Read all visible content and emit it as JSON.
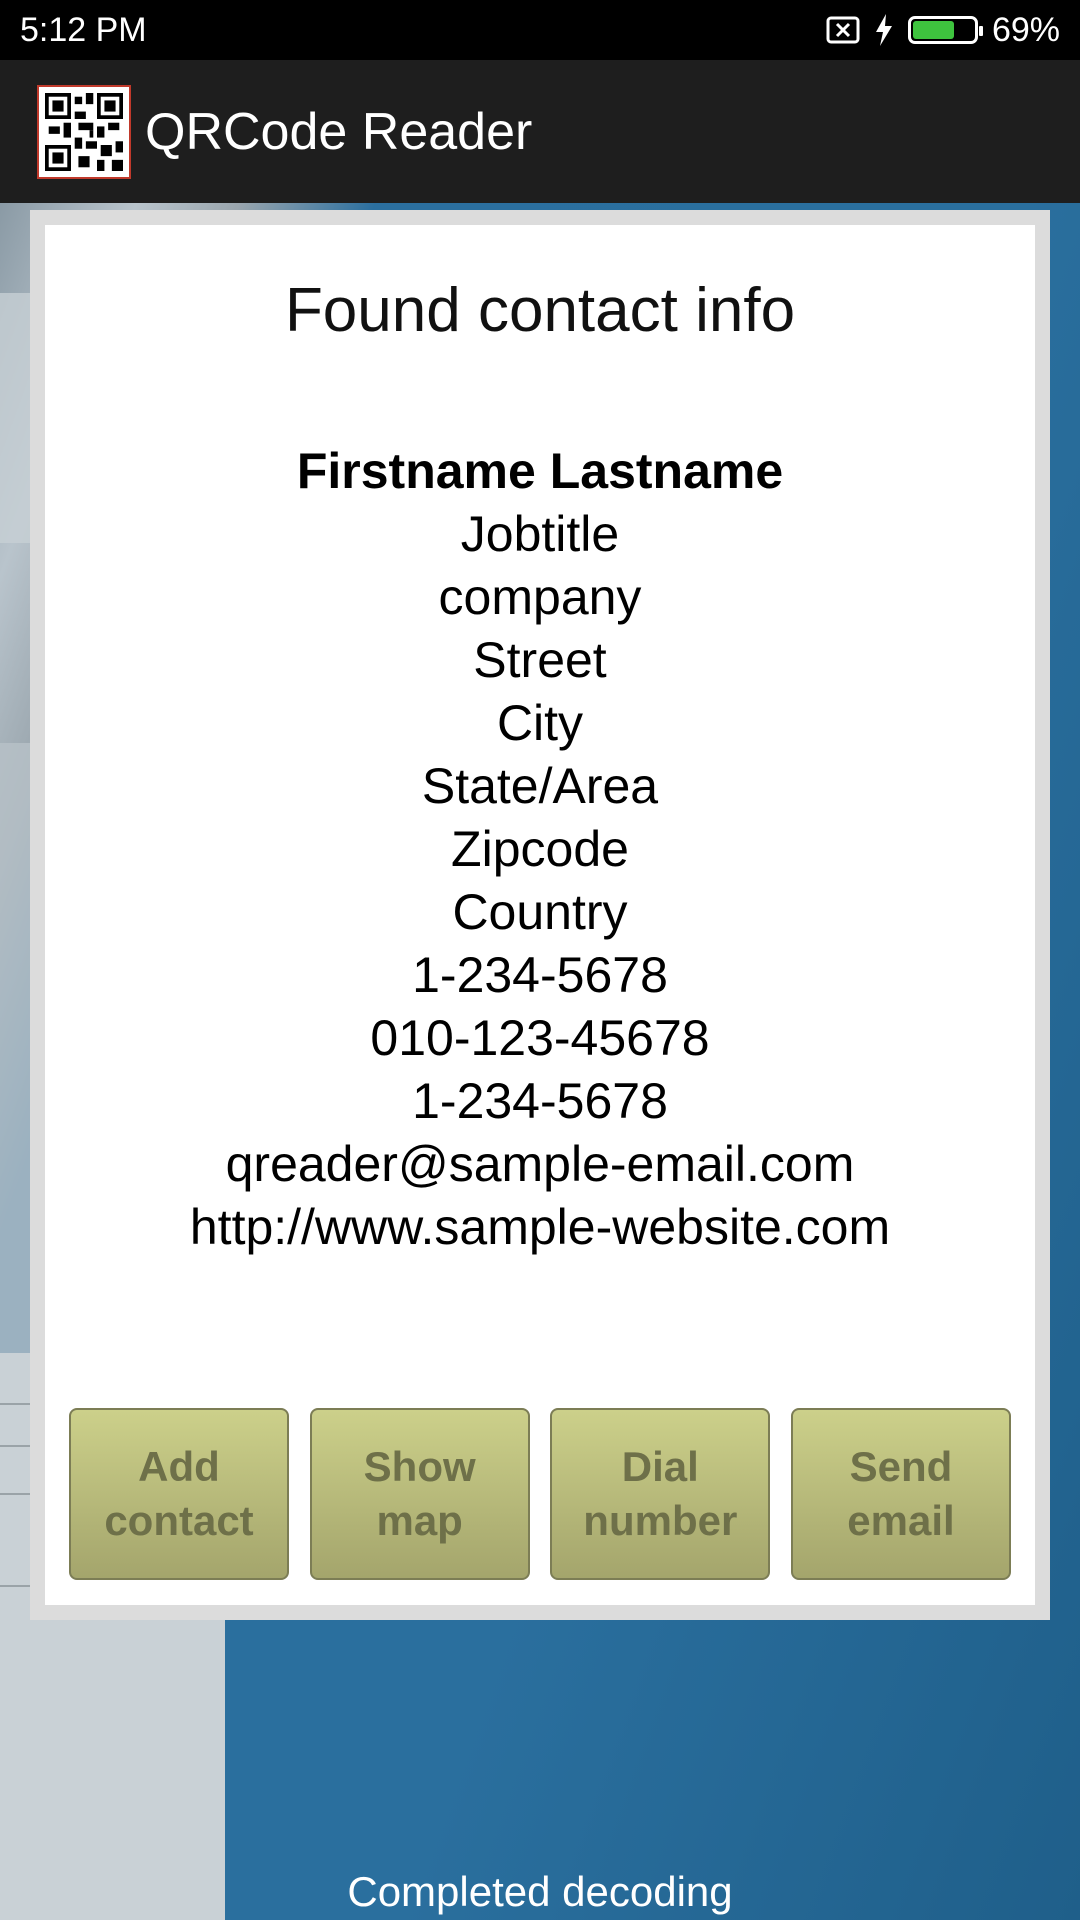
{
  "status_bar": {
    "time": "5:12 PM",
    "battery": "69%",
    "battery_level": 0.69,
    "icons": [
      "no-sim-icon",
      "charging-bolt-icon",
      "battery-icon"
    ]
  },
  "app_bar": {
    "title": "QRCode Reader",
    "icon": "qr-code-icon"
  },
  "dialog": {
    "title": "Found contact info",
    "contact": {
      "name": "Firstname Lastname",
      "lines": [
        "Jobtitle",
        "company",
        "Street",
        "City",
        "State/Area",
        "Zipcode",
        "Country",
        "1-234-5678",
        "010-123-45678",
        "1-234-5678",
        "qreader@sample-email.com",
        "http://www.sample-website.com"
      ]
    },
    "buttons": {
      "add_contact": "Add\ncontact",
      "show_map": "Show\nmap",
      "dial_number": "Dial\nnumber",
      "send_email": "Send\nemail"
    }
  },
  "footer": {
    "status": "Completed decoding"
  },
  "colors": {
    "button_top": "#ccd08a",
    "button_bottom": "#a4a56c",
    "button_text": "#6e7049",
    "battery_fill": "#3ec43e"
  }
}
